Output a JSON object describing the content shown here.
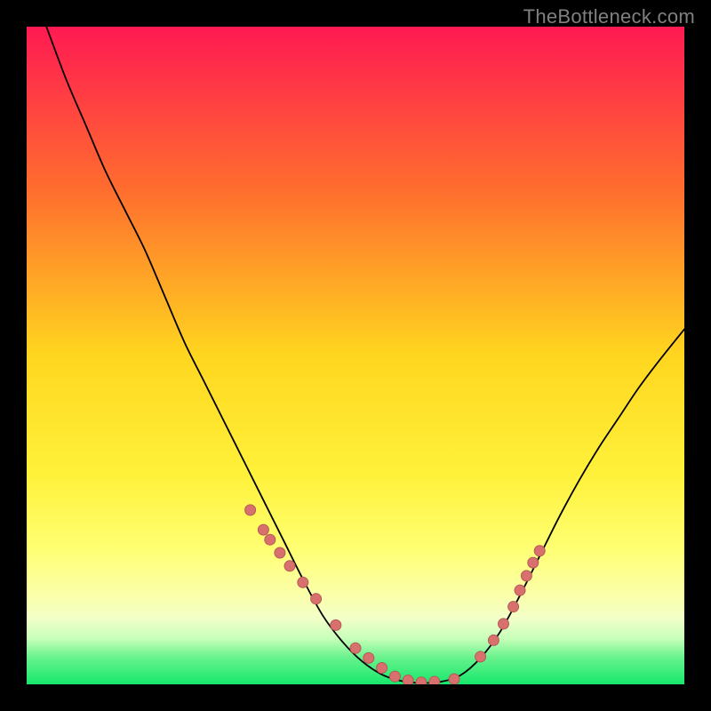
{
  "watermark": "TheBottleneck.com",
  "colors": {
    "frame_bg": "#000000",
    "curve": "#000000",
    "marker_fill": "#d8716e",
    "marker_stroke": "#b45a57",
    "gradient_stops": [
      {
        "offset": 0,
        "color": "#ff1a52"
      },
      {
        "offset": 0.25,
        "color": "#ff6e2e"
      },
      {
        "offset": 0.5,
        "color": "#ffd61f"
      },
      {
        "offset": 0.68,
        "color": "#fff13a"
      },
      {
        "offset": 0.79,
        "color": "#ffff70"
      },
      {
        "offset": 0.86,
        "color": "#fbffa6"
      },
      {
        "offset": 0.9,
        "color": "#f2ffc8"
      },
      {
        "offset": 0.93,
        "color": "#c8ffba"
      },
      {
        "offset": 0.96,
        "color": "#66f28c"
      },
      {
        "offset": 1.0,
        "color": "#17e86b"
      }
    ]
  },
  "chart_data": {
    "type": "line",
    "title": null,
    "xlabel": null,
    "ylabel": null,
    "x_range": [
      0,
      100
    ],
    "y_range": [
      0,
      100
    ],
    "legend": null,
    "note": "Curved bottleneck curve. y approximates 'bottleneck-like badness' (red=high, green=low). Values are read off the plotted shape relative to the gradient background; no numeric axes or ticks are rendered.",
    "series": [
      {
        "name": "curve",
        "color": "#000000",
        "x": [
          0,
          3,
          6,
          9,
          12,
          15,
          18,
          21,
          24,
          27,
          30,
          33,
          36,
          39,
          42,
          45,
          48,
          51,
          54,
          57,
          60,
          63,
          66,
          69,
          72,
          75,
          78,
          81,
          84,
          87,
          90,
          93,
          96,
          100
        ],
        "y": [
          108,
          100,
          92,
          85,
          78,
          72,
          66,
          59,
          52,
          46,
          40,
          34,
          28,
          22,
          16,
          10.5,
          6.5,
          3.5,
          1.5,
          0.5,
          0.2,
          0.4,
          1.4,
          4,
          8,
          13.5,
          19.5,
          25.5,
          31,
          36,
          40.5,
          45,
          49,
          54
        ]
      }
    ],
    "markers": {
      "name": "sample-points",
      "color": "#d8716e",
      "x": [
        34,
        36,
        37,
        38.5,
        40,
        42,
        44,
        47,
        50,
        52,
        54,
        56,
        58,
        60,
        62,
        65,
        69,
        71,
        72.5,
        74,
        75,
        76,
        77,
        78
      ],
      "y": [
        26.5,
        23.5,
        22,
        20,
        18,
        15.5,
        13,
        9,
        5.5,
        4,
        2.5,
        1.2,
        0.6,
        0.3,
        0.4,
        0.8,
        4.2,
        6.7,
        9.2,
        11.8,
        14.3,
        16.5,
        18.5,
        20.3
      ]
    }
  }
}
